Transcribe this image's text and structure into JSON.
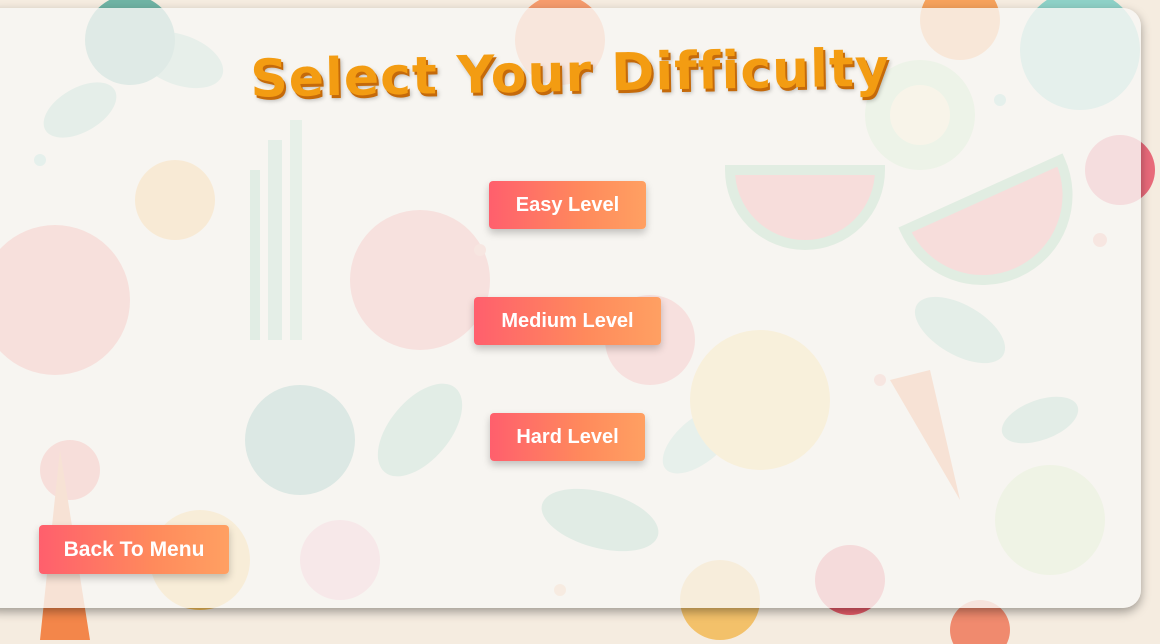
{
  "page": {
    "title": "Select Your Difficulty"
  },
  "levels": [
    {
      "label": "Easy Level"
    },
    {
      "label": "Medium Level"
    },
    {
      "label": "Hard Level"
    }
  ],
  "back_button": {
    "label": "Back To Menu"
  },
  "colors": {
    "title": "#f39c12",
    "button_gradient_start": "#ff5f6d",
    "button_gradient_end": "#ffa062",
    "panel": "#f8f6f4"
  }
}
